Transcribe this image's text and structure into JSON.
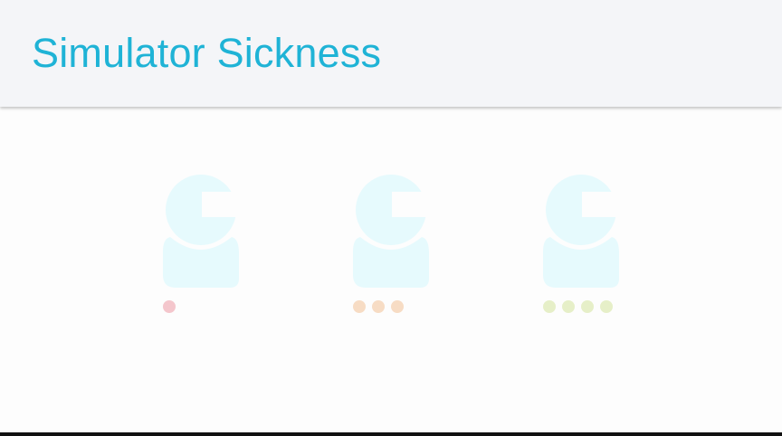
{
  "header": {
    "title": "Simulator Sickness"
  },
  "options": [
    {
      "level": 1,
      "icon": "user-icon",
      "dot_color": "#f4c6cc"
    },
    {
      "level": 3,
      "icon": "user-icon",
      "dot_color": "#f7dcc4"
    },
    {
      "level": 4,
      "icon": "user-icon",
      "dot_color": "#e6efc8"
    }
  ],
  "colors": {
    "accent": "#1fb3d6",
    "icon_fill": "#e6fafd"
  }
}
